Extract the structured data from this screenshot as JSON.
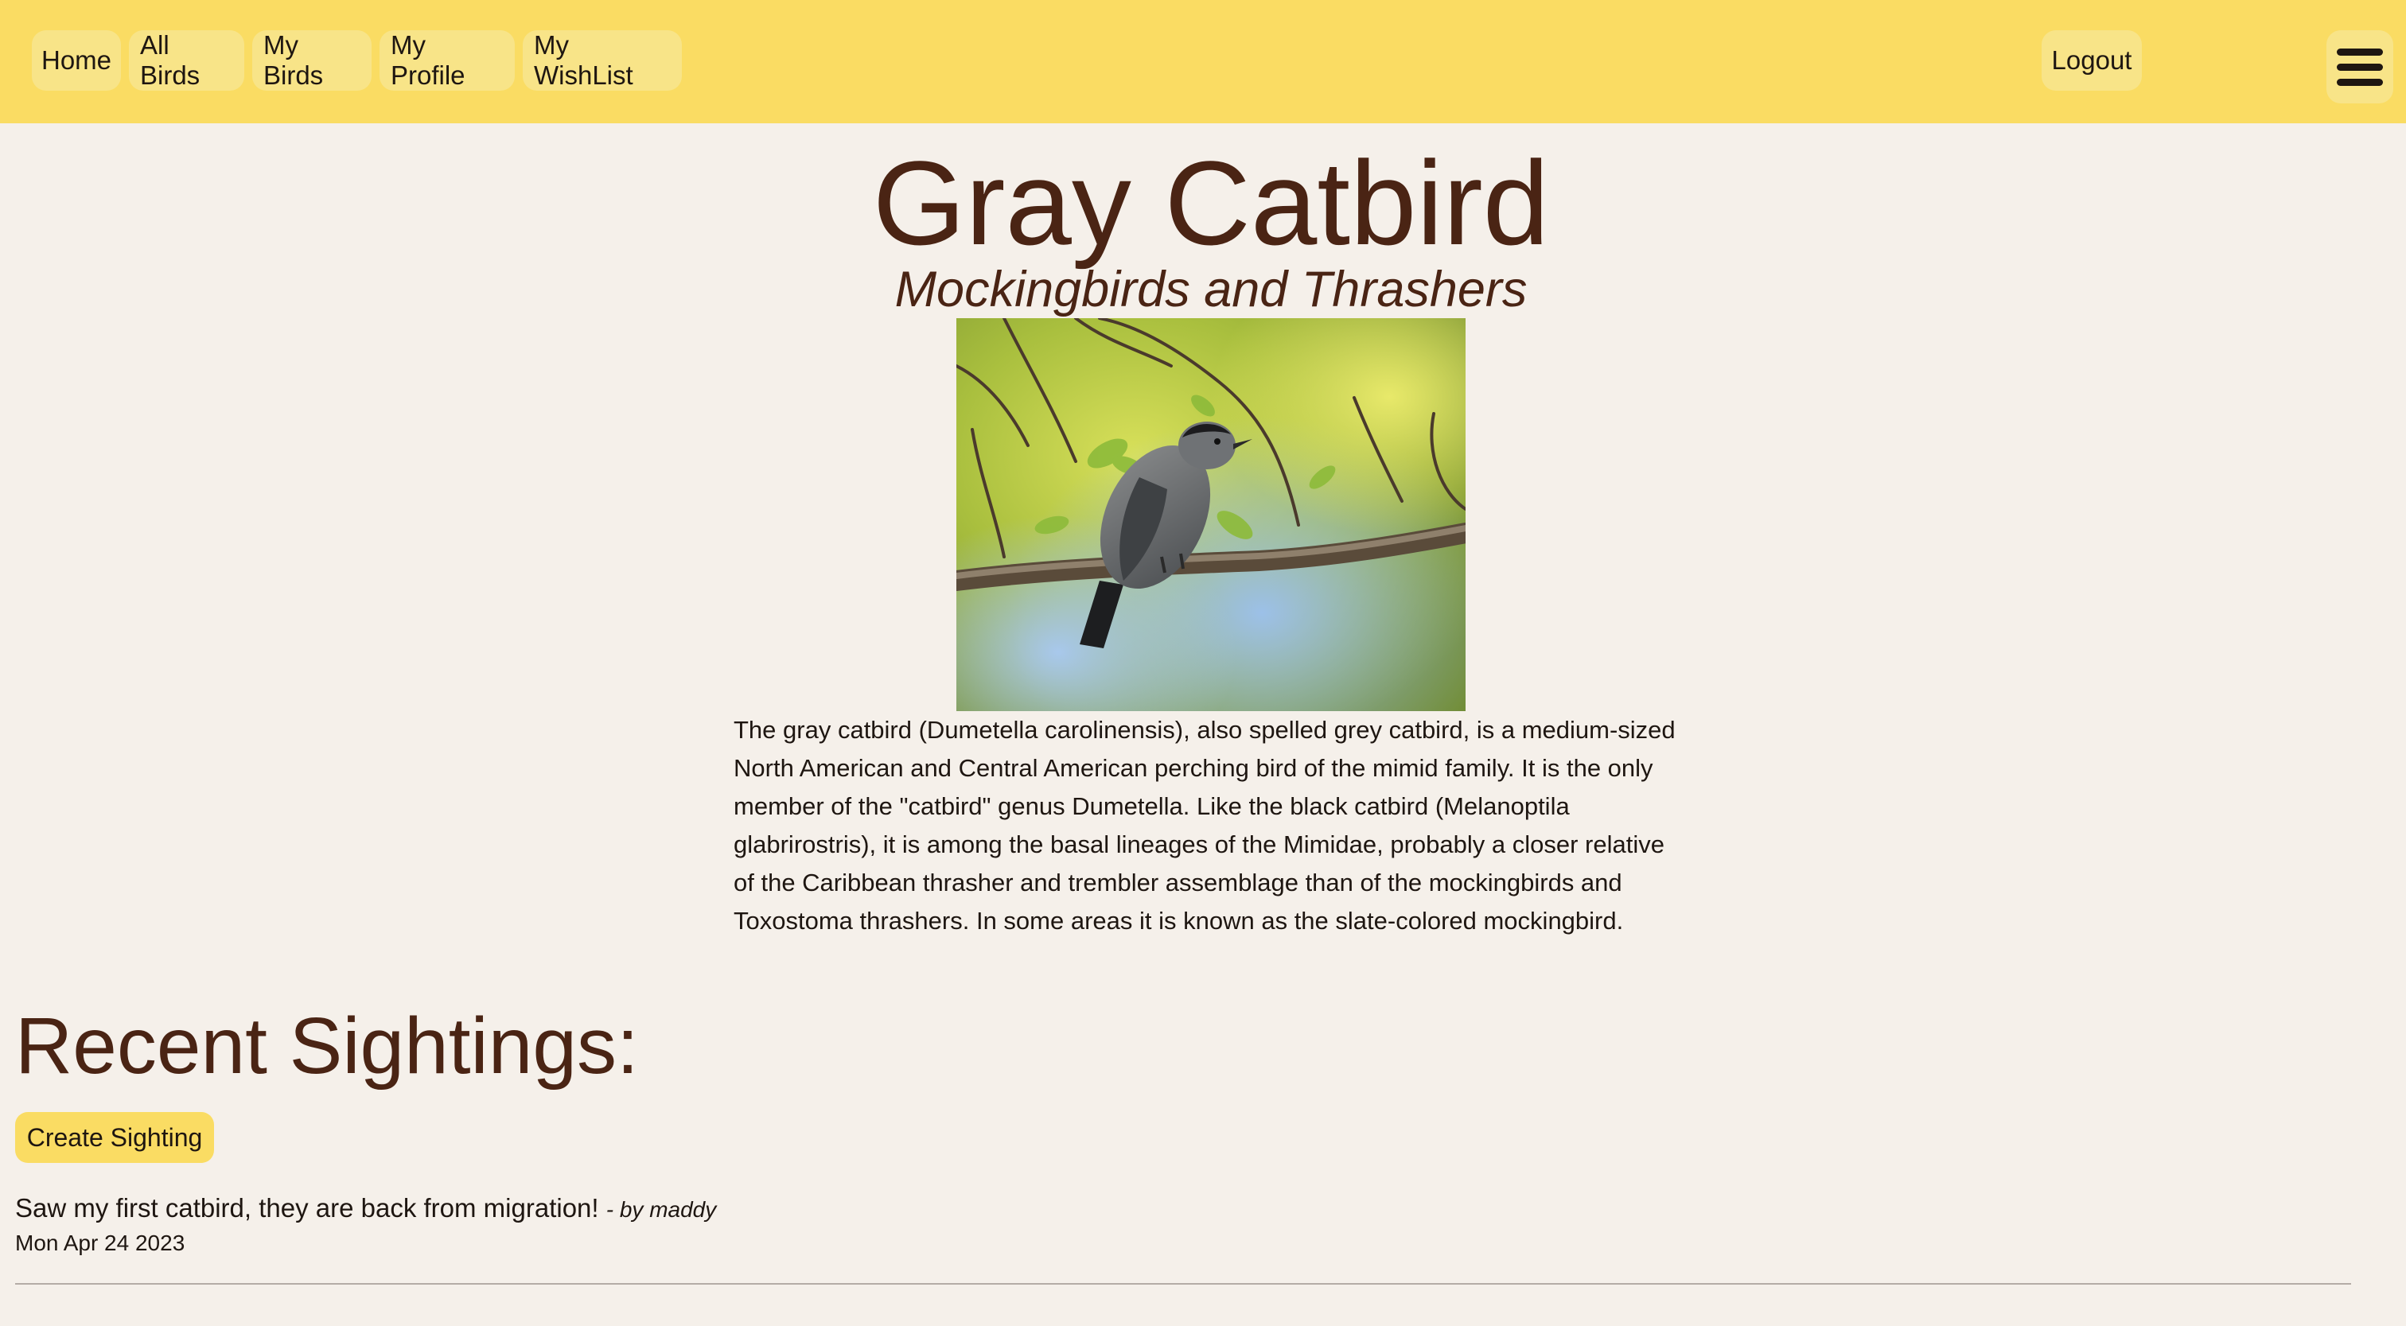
{
  "nav": {
    "links": [
      "Home",
      "All Birds",
      "My Birds",
      "My Profile",
      "My WishList"
    ],
    "logout_label": "Logout",
    "menu_icon": "hamburger-menu-icon"
  },
  "bird": {
    "name": "Gray Catbird",
    "family": "Mockingbirds and Thrashers",
    "photo": "gray-catbird-on-branch",
    "description": "The gray catbird (Dumetella carolinensis), also spelled grey catbird, is a medium-sized North American and Central American perching bird of the mimid family. It is the only member of the \"catbird\" genus Dumetella. Like the black catbird (Melanoptila glabrirostris), it is among the basal lineages of the Mimidae, probably a closer relative of the Caribbean thrasher and trembler assemblage than of the mockingbirds and Toxostoma thrashers. In some areas it is known as the slate-colored mockingbird."
  },
  "sightings": {
    "heading": "Recent Sightings:",
    "create_label": "Create Sighting",
    "items": [
      {
        "text": "Saw my first catbird, they are back from migration!",
        "author": "- by maddy",
        "date": "Mon Apr 24 2023"
      }
    ]
  },
  "colors": {
    "nav_bg": "#fadc63",
    "page_bg": "#f5f0ea",
    "heading_text": "#4a2414",
    "button_bg": "#f8e488"
  }
}
